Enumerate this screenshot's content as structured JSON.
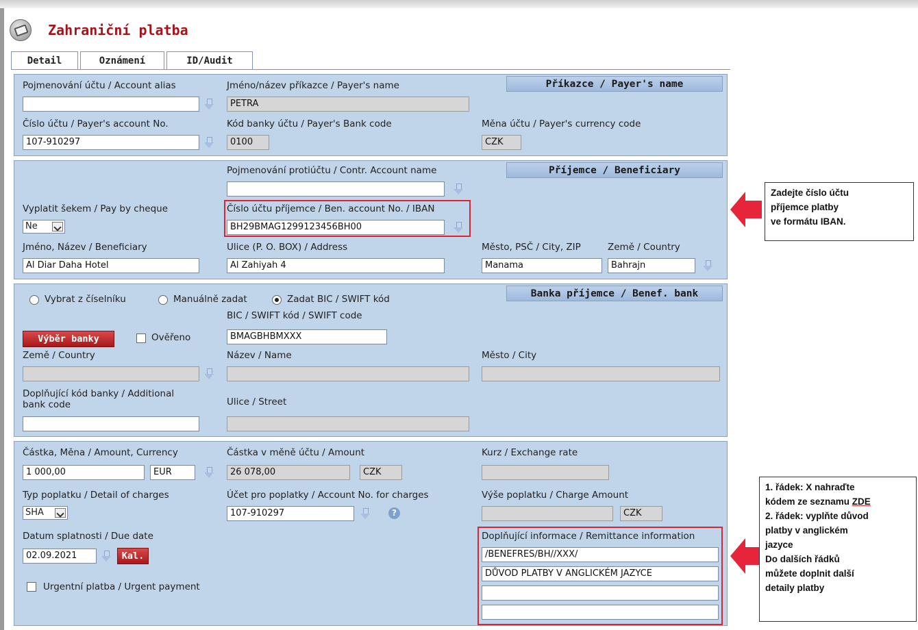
{
  "window": {
    "title": "Zahraniční platba",
    "logo_icon": "payment-logo-icon"
  },
  "tabs": [
    {
      "label": "Detail",
      "active": true
    },
    {
      "label": "Oznámení",
      "active": false
    },
    {
      "label": "ID/Audit",
      "active": false
    }
  ],
  "payer": {
    "section_title": "Příkazce / Payer's name",
    "account_alias_label": "Pojmenování účtu / Account alias",
    "account_alias_value": "",
    "payer_name_label": "Jméno/název příkazce / Payer's name",
    "payer_name_value": "PETRA",
    "account_no_label": "Číslo účtu / Payer's account No.",
    "account_no_value": "107-910297",
    "bank_code_label": "Kód banky účtu / Payer's Bank code",
    "bank_code_value": "0100",
    "currency_label": "Měna účtu / Payer's currency code",
    "currency_value": "CZK"
  },
  "beneficiary": {
    "section_title": "Příjemce / Beneficiary",
    "contr_account_name_label": "Pojmenování protiúčtu / Contr. Account name",
    "contr_account_name_value": "",
    "pay_by_cheque_label": "Vyplatit šekem / Pay by cheque",
    "pay_by_cheque_value": "Ne",
    "account_no_label": "Číslo účtu příjemce / Ben. account No. / IBAN",
    "account_no_value": "BH29BMAG1299123456BH00",
    "name_label": "Jméno, Název / Beneficiary",
    "name_value": "Al Diar Daha Hotel",
    "address_label": "Ulice (P. O. BOX) / Address",
    "address_value": "Al Zahiyah 4",
    "city_label": "Město, PSČ / City, ZIP",
    "city_value": "Manama",
    "country_label": "Země / Country",
    "country_value": "Bahrajn"
  },
  "bank": {
    "section_title": "Banka příjemce / Benef. bank",
    "radio_options": [
      "Vybrat z číselníku",
      "Manuálně zadat",
      "Zadat BIC / SWIFT kód"
    ],
    "radio_selected": "Zadat BIC / SWIFT kód",
    "select_bank_button": "Výběr banky",
    "verified_label": "Ověřeno",
    "swift_label": "BIC / SWIFT kód / SWIFT code",
    "swift_value": "BMAGBHBMXXX",
    "country_label": "Země / Country",
    "name_label": "Název / Name",
    "city_label": "Město / City",
    "additional_code_label_1": "Doplňující kód banky / Additional",
    "additional_code_label_2": "bank code",
    "street_label": "Ulice / Street"
  },
  "amount": {
    "amount_label": "Částka, Měna / Amount, Currency",
    "amount_value": "1 000,00",
    "currency_value": "EUR",
    "account_amount_label": "Částka v měně účtu / Amount",
    "account_amount_value": "26 078,00",
    "account_currency_value": "CZK",
    "exchange_rate_label": "Kurz / Exchange rate",
    "charges_type_label": "Typ poplatku / Detail of charges",
    "charges_type_value": "SHA",
    "charges_account_label": "Účet pro poplatky / Account No. for charges",
    "charges_account_value": "107-910297",
    "charge_amount_label": "Výše poplatku / Charge Amount",
    "charge_currency_value": "CZK",
    "due_date_label": "Datum splatnosti / Due date",
    "due_date_value": "02.09.2021",
    "calendar_button": "Kal.",
    "urgent_label": "Urgentní platba / Urgent payment",
    "remittance_label": "Doplňující informace / Remittance information",
    "remittance_lines": [
      "/BENEFRES/BH//XXX/",
      "DŮVOD PLATBY V ANGLICKÉM JAZYCE",
      "",
      ""
    ]
  },
  "callouts": {
    "iban": [
      "Zadejte číslo účtu",
      "příjemce platby",
      "ve formátu IBAN."
    ],
    "remittance": {
      "line1a": "1. řádek: X nahraďte",
      "line1b_prefix": "kódem ze seznamu ",
      "line1b_link": "ZDE",
      "line2": [
        "2. řádek: vyplňte důvod",
        "platby v anglickém",
        "jazyce"
      ],
      "line3": [
        "Do dalších řádků",
        "můžete doplnit další",
        "detaily platby"
      ]
    }
  },
  "colors": {
    "panel": "#c0d4ea",
    "accent_red": "#e0232f",
    "title_red": "#a4141a"
  }
}
